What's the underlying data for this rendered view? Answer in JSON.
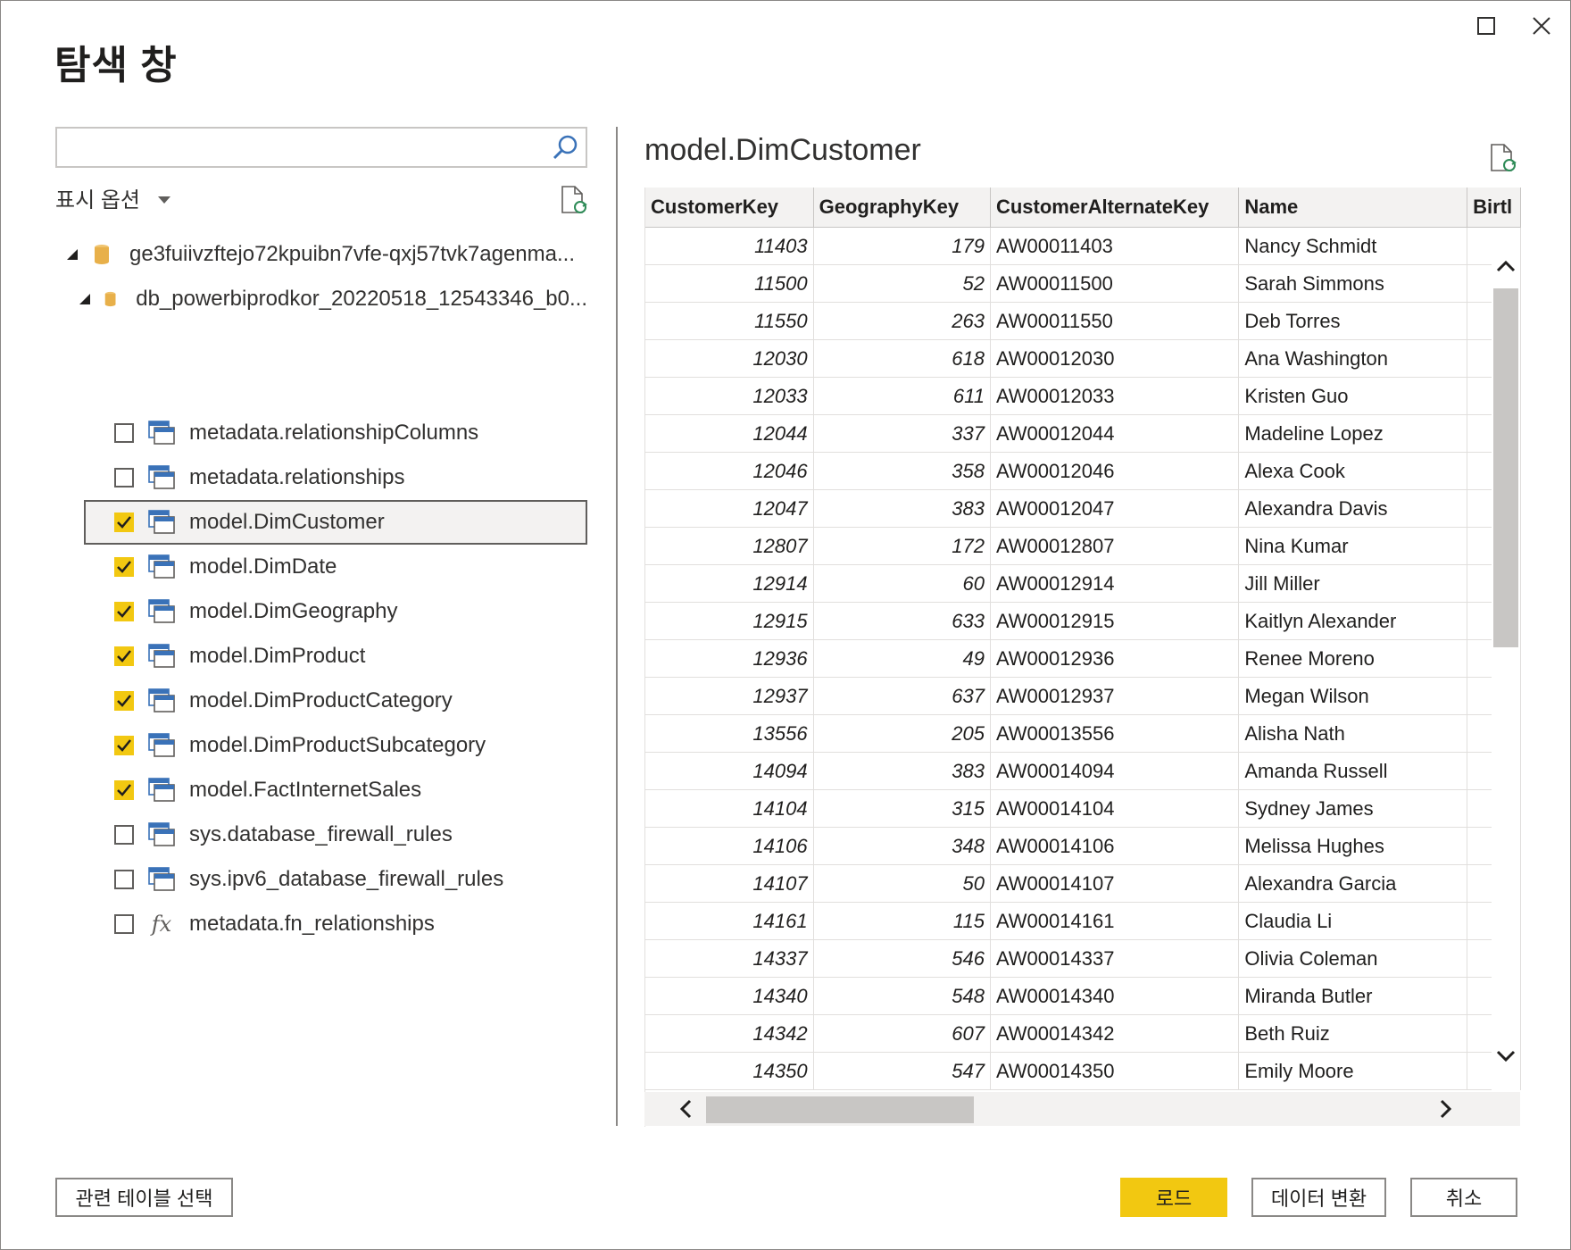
{
  "window": {
    "title": "탐색 창",
    "maximize_label": "□",
    "close_label": "✕"
  },
  "left": {
    "search": {
      "value": "",
      "placeholder": ""
    },
    "display_options_label": "표시 옵션",
    "tree": {
      "server": "ge3fuiivzftejo72kpuibn7vfe-qxj57tvk7agenma...",
      "database": "db_powerbiprodkor_20220518_12543346_b0...",
      "items": [
        {
          "label": "metadata.relationshipColumns",
          "checked": false,
          "icon": "table-icon"
        },
        {
          "label": "metadata.relationships",
          "checked": false,
          "icon": "table-icon"
        },
        {
          "label": "model.DimCustomer",
          "checked": true,
          "icon": "table-icon",
          "selected": true
        },
        {
          "label": "model.DimDate",
          "checked": true,
          "icon": "table-icon"
        },
        {
          "label": "model.DimGeography",
          "checked": true,
          "icon": "table-icon"
        },
        {
          "label": "model.DimProduct",
          "checked": true,
          "icon": "table-icon"
        },
        {
          "label": "model.DimProductCategory",
          "checked": true,
          "icon": "table-icon"
        },
        {
          "label": "model.DimProductSubcategory",
          "checked": true,
          "icon": "table-icon"
        },
        {
          "label": "model.FactInternetSales",
          "checked": true,
          "icon": "table-icon"
        },
        {
          "label": "sys.database_firewall_rules",
          "checked": false,
          "icon": "table-icon"
        },
        {
          "label": "sys.ipv6_database_firewall_rules",
          "checked": false,
          "icon": "table-icon"
        },
        {
          "label": "metadata.fn_relationships",
          "checked": false,
          "icon": "function-icon"
        }
      ],
      "fx_glyph": "fx"
    }
  },
  "preview": {
    "title": "model.DimCustomer",
    "columns": [
      "CustomerKey",
      "GeographyKey",
      "CustomerAlternateKey",
      "Name",
      "Birtl"
    ],
    "rows": [
      [
        "11403",
        "179",
        "AW00011403",
        "Nancy Schmidt",
        ""
      ],
      [
        "11500",
        "52",
        "AW00011500",
        "Sarah Simmons",
        ""
      ],
      [
        "11550",
        "263",
        "AW00011550",
        "Deb Torres",
        ""
      ],
      [
        "12030",
        "618",
        "AW00012030",
        "Ana Washington",
        ""
      ],
      [
        "12033",
        "611",
        "AW00012033",
        "Kristen Guo",
        ""
      ],
      [
        "12044",
        "337",
        "AW00012044",
        "Madeline Lopez",
        ""
      ],
      [
        "12046",
        "358",
        "AW00012046",
        "Alexa Cook",
        ""
      ],
      [
        "12047",
        "383",
        "AW00012047",
        "Alexandra Davis",
        ""
      ],
      [
        "12807",
        "172",
        "AW00012807",
        "Nina Kumar",
        ""
      ],
      [
        "12914",
        "60",
        "AW00012914",
        "Jill Miller",
        ""
      ],
      [
        "12915",
        "633",
        "AW00012915",
        "Kaitlyn Alexander",
        ""
      ],
      [
        "12936",
        "49",
        "AW00012936",
        "Renee Moreno",
        ""
      ],
      [
        "12937",
        "637",
        "AW00012937",
        "Megan Wilson",
        ""
      ],
      [
        "13556",
        "205",
        "AW00013556",
        "Alisha Nath",
        ""
      ],
      [
        "14094",
        "383",
        "AW00014094",
        "Amanda Russell",
        ""
      ],
      [
        "14104",
        "315",
        "AW00014104",
        "Sydney James",
        ""
      ],
      [
        "14106",
        "348",
        "AW00014106",
        "Melissa Hughes",
        ""
      ],
      [
        "14107",
        "50",
        "AW00014107",
        "Alexandra Garcia",
        ""
      ],
      [
        "14161",
        "115",
        "AW00014161",
        "Claudia Li",
        ""
      ],
      [
        "14337",
        "546",
        "AW00014337",
        "Olivia Coleman",
        ""
      ],
      [
        "14340",
        "548",
        "AW00014340",
        "Miranda Butler",
        ""
      ],
      [
        "14342",
        "607",
        "AW00014342",
        "Beth Ruiz",
        ""
      ],
      [
        "14350",
        "547",
        "AW00014350",
        "Emily Moore",
        ""
      ]
    ]
  },
  "footer": {
    "related_tables_label": "관련 테이블 선택",
    "load_label": "로드",
    "transform_label": "데이터 변환",
    "cancel_label": "취소"
  },
  "colors": {
    "accent": "#f2c811",
    "border": "#8a8886",
    "header_bg": "#f3f2f1",
    "db_icon": "#e8b04a",
    "table_icon": "#3a72b8"
  }
}
